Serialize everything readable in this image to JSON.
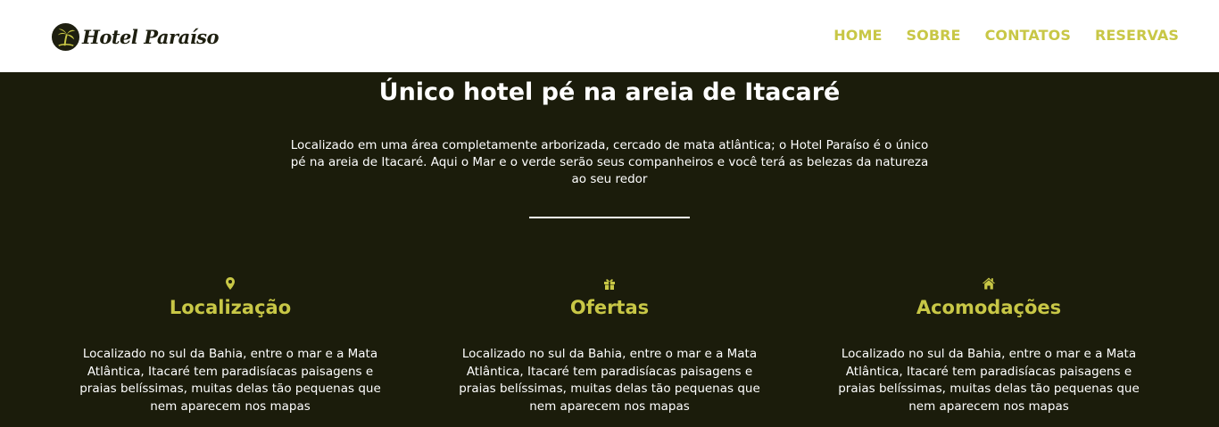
{
  "brand": {
    "name": "Hotel Paraíso",
    "logo_icon": "palm-tree-icon",
    "colors": {
      "accent": "#c8c746",
      "dark": "#1b1c0b",
      "nav_bg": "#ffffff",
      "text_light": "#ffffff"
    }
  },
  "nav": {
    "items": [
      {
        "label": "HOME"
      },
      {
        "label": "SOBRE"
      },
      {
        "label": "CONTATOS"
      },
      {
        "label": "RESERVAS"
      }
    ]
  },
  "hero": {
    "title": "Único hotel pé na areia de Itacaré",
    "description": "Localizado em uma área completamente arborizada, cercado de mata atlântica; o Hotel Paraíso é o único pé na areia de Itacaré. Aqui o Mar e o verde serão seus companheiros e você terá as belezas da natureza ao seu redor"
  },
  "features": [
    {
      "icon": "map-marker-icon",
      "title": "Localização",
      "text": "Localizado no sul da Bahia, entre o mar e a Mata Atlântica, Itacaré tem paradisíacas paisagens e praias belíssimas, muitas delas tão pequenas que nem aparecem nos mapas"
    },
    {
      "icon": "gift-icon",
      "title": "Ofertas",
      "text": "Localizado no sul da Bahia, entre o mar e a Mata Atlântica, Itacaré tem paradisíacas paisagens e praias belíssimas, muitas delas tão pequenas que nem aparecem nos mapas"
    },
    {
      "icon": "home-icon",
      "title": "Acomodações",
      "text": "Localizado no sul da Bahia, entre o mar e a Mata Atlântica, Itacaré tem paradisíacas paisagens e praias belíssimas, muitas delas tão pequenas que nem aparecem nos mapas"
    }
  ]
}
